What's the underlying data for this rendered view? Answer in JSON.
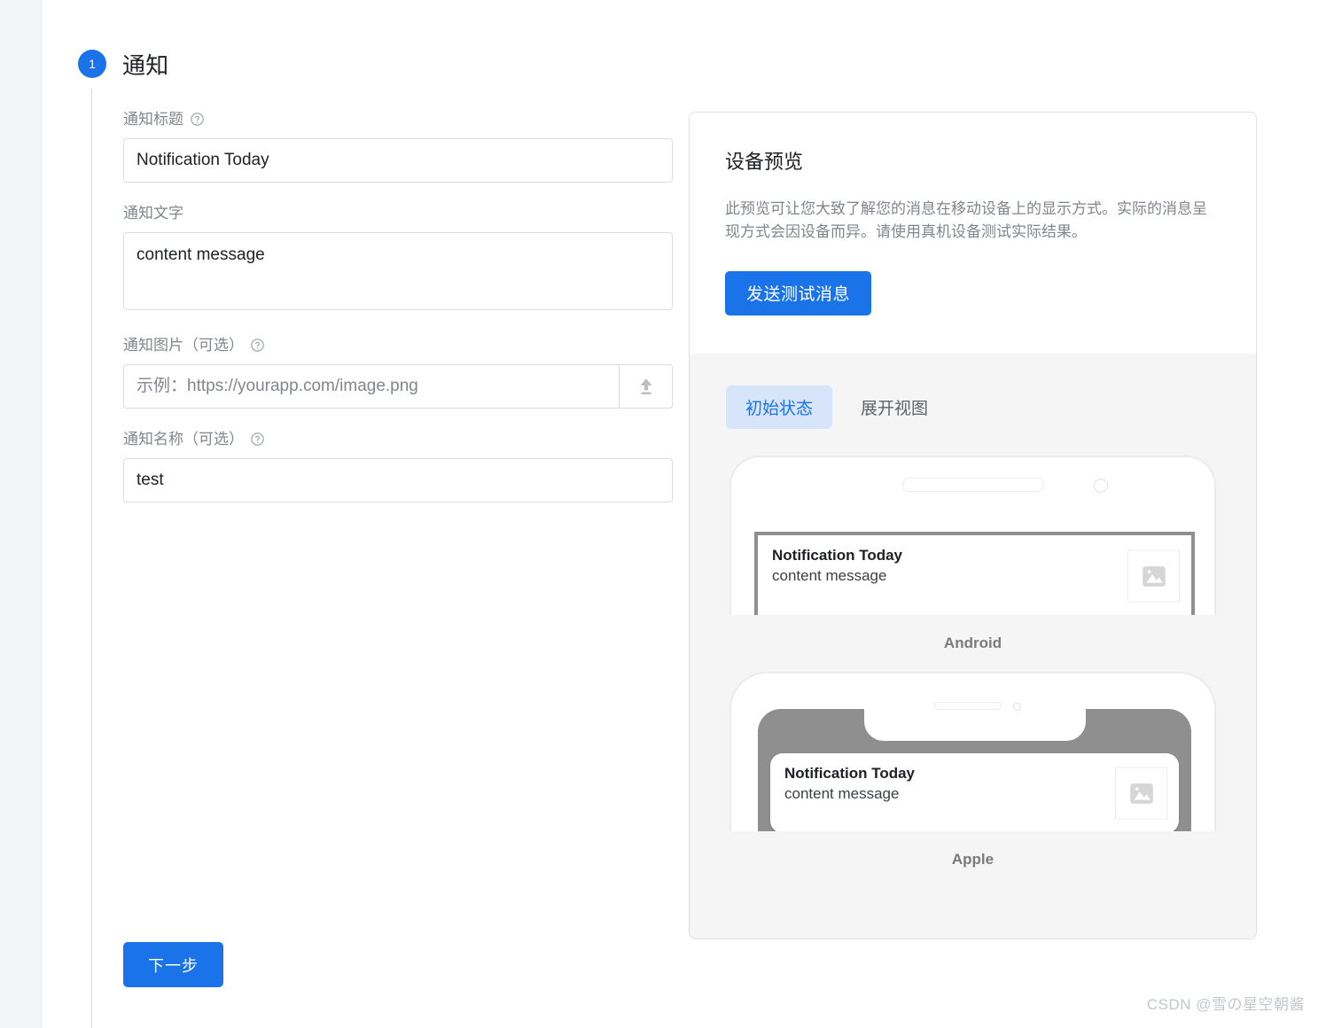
{
  "step": {
    "number": "1",
    "title": "通知"
  },
  "form": {
    "title_label": "通知标题",
    "title_help_icon": "help-circle-icon",
    "title_value": "Notification Today",
    "title_placeholder": "",
    "body_label": "通知文字",
    "body_value": "content message",
    "body_placeholder": "",
    "image_label": "通知图片（可选）",
    "image_help_icon": "help-circle-icon",
    "image_value": "",
    "image_placeholder": "示例：https://yourapp.com/image.png",
    "upload_icon": "upload-icon",
    "name_label": "通知名称（可选）",
    "name_help_icon": "help-circle-icon",
    "name_value": "test",
    "name_placeholder": "",
    "next_label": "下一步"
  },
  "preview": {
    "title": "设备预览",
    "description": "此预览可让您大致了解您的消息在移动设备上的显示方式。实际的消息呈现方式会因设备而异。请使用真机设备测试实际结果。",
    "send_test_label": "发送测试消息",
    "tabs": [
      {
        "label": "初始状态",
        "active": true
      },
      {
        "label": "展开视图",
        "active": false
      }
    ],
    "devices": [
      {
        "label": "Android",
        "notification": {
          "title": "Notification Today",
          "body": "content message",
          "thumb_icon": "image-placeholder-icon"
        }
      },
      {
        "label": "Apple",
        "notification": {
          "title": "Notification Today",
          "body": "content message",
          "thumb_icon": "image-placeholder-icon"
        }
      }
    ]
  },
  "watermark": "CSDN @雪の星空朝酱",
  "colors": {
    "accent": "#1a73e8",
    "tab_active_bg": "#d7e5fb",
    "panel_bg": "#f5f5f5",
    "border": "#dadce0",
    "label_text": "#80868b"
  }
}
